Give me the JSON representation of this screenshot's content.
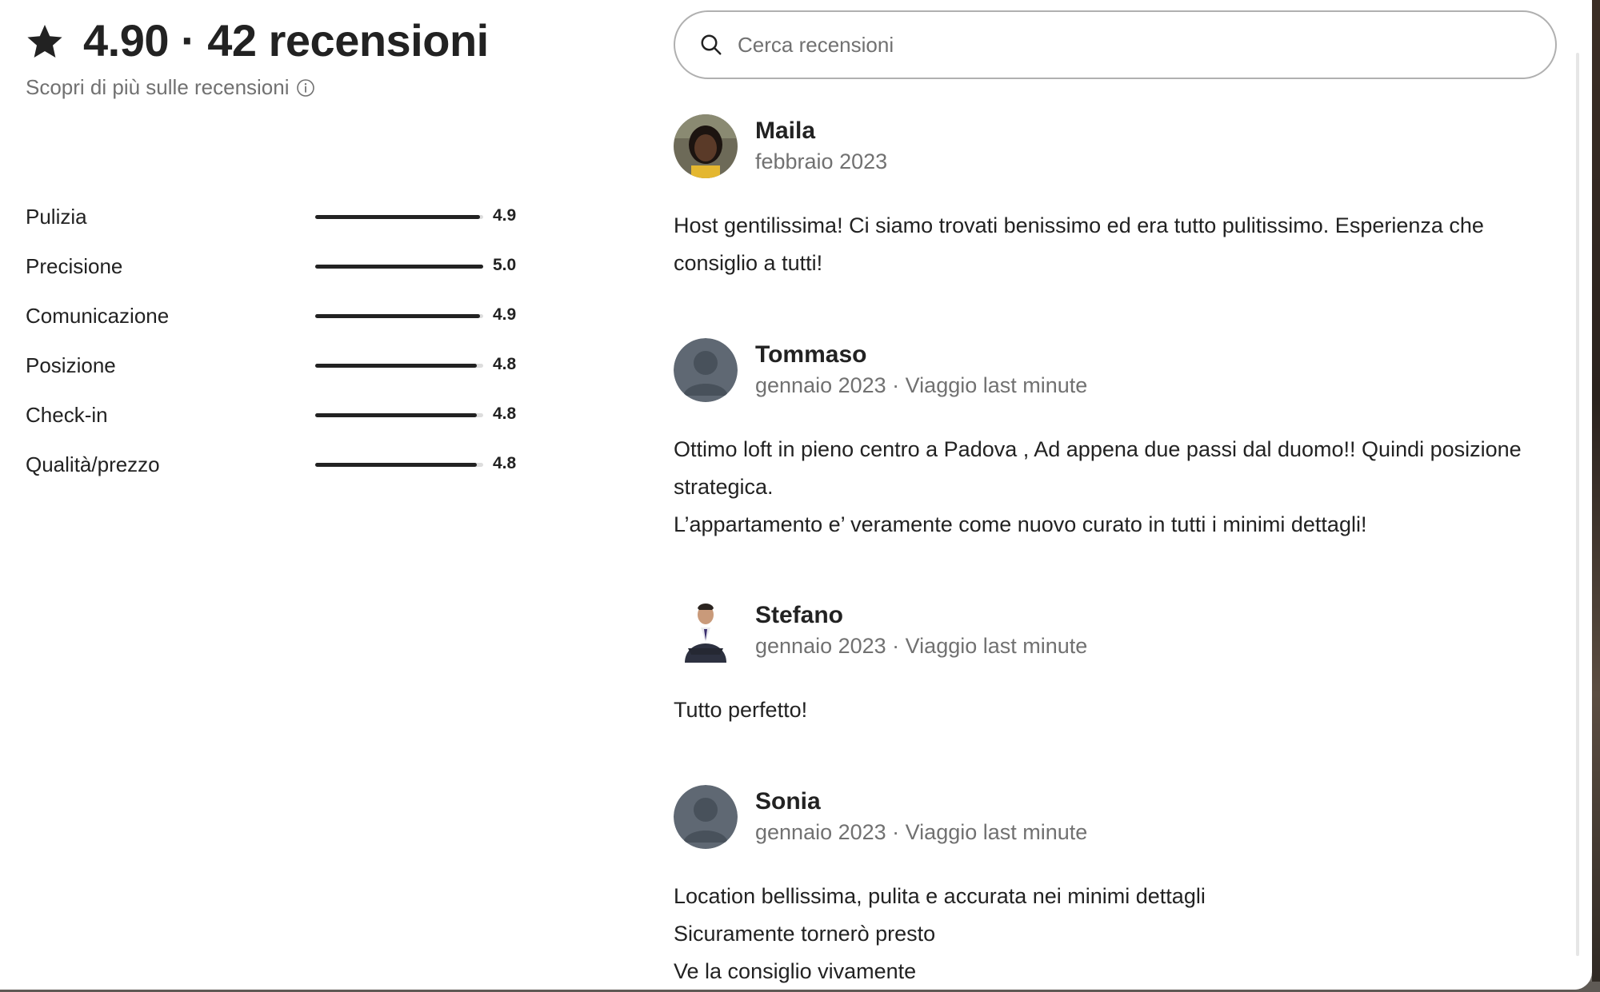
{
  "summary": {
    "headline": "4.90 · 42 recensioni",
    "learn_more": "Scopri di più sulle recensioni"
  },
  "ratings": [
    {
      "label": "Pulizia",
      "value": "4.9",
      "score": 4.9
    },
    {
      "label": "Precisione",
      "value": "5.0",
      "score": 5.0
    },
    {
      "label": "Comunicazione",
      "value": "4.9",
      "score": 4.9
    },
    {
      "label": "Posizione",
      "value": "4.8",
      "score": 4.8
    },
    {
      "label": "Check-in",
      "value": "4.8",
      "score": 4.8
    },
    {
      "label": "Qualità/prezzo",
      "value": "4.8",
      "score": 4.8
    }
  ],
  "search": {
    "placeholder": "Cerca recensioni"
  },
  "reviews": [
    {
      "name": "Maila",
      "date": "febbraio 2023",
      "avatar": "photo-woman",
      "lines": [
        "Host gentilissima! Ci siamo trovati benissimo ed era tutto pulitissimo. Esperienza che consiglio a tutti!"
      ]
    },
    {
      "name": "Tommaso",
      "date": "gennaio 2023 · Viaggio last minute",
      "avatar": "default-user-icon",
      "lines": [
        "Ottimo loft in pieno centro a Padova , Ad appena due passi dal duomo!! Quindi posizione strategica.",
        "L’appartamento e’ veramente come nuovo curato in tutti i minimi dettagli!"
      ]
    },
    {
      "name": "Stefano",
      "date": "gennaio 2023 · Viaggio last minute",
      "avatar": "photo-man-suit",
      "lines": [
        "Tutto perfetto!"
      ]
    },
    {
      "name": "Sonia",
      "date": "gennaio 2023 · Viaggio last minute",
      "avatar": "default-user-icon",
      "lines": [
        "Location bellissima, pulita e accurata nei minimi dettagli",
        "Sicuramente tornerò presto",
        "Ve la consiglio vivamente"
      ]
    }
  ],
  "colors": {
    "text_primary": "#222222",
    "text_secondary": "#717171",
    "track": "#dddddd",
    "default_avatar": "#5f6873"
  }
}
